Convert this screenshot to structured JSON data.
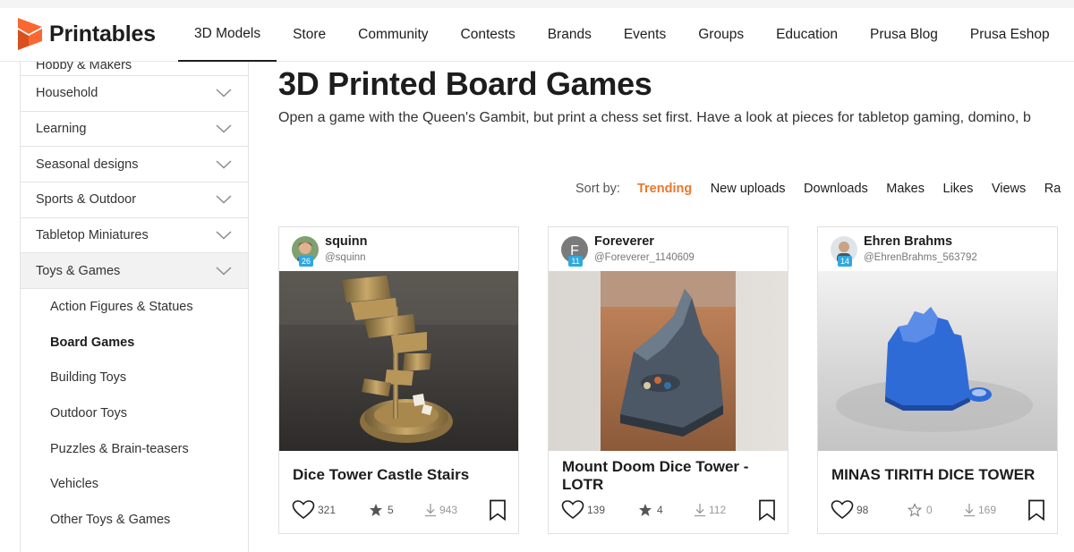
{
  "brand": {
    "name": "Printables"
  },
  "nav": [
    {
      "label": "3D Models",
      "active": true
    },
    {
      "label": "Store"
    },
    {
      "label": "Community"
    },
    {
      "label": "Contests"
    },
    {
      "label": "Brands"
    },
    {
      "label": "Events"
    },
    {
      "label": "Groups"
    },
    {
      "label": "Education"
    },
    {
      "label": "Prusa Blog"
    },
    {
      "label": "Prusa Eshop"
    }
  ],
  "sidebar": {
    "categories": [
      {
        "label": "Hobby & Makers"
      },
      {
        "label": "Household"
      },
      {
        "label": "Learning"
      },
      {
        "label": "Seasonal designs"
      },
      {
        "label": "Sports & Outdoor"
      },
      {
        "label": "Tabletop Miniatures"
      },
      {
        "label": "Toys & Games"
      }
    ],
    "subcategories": [
      {
        "label": "Action Figures & Statues"
      },
      {
        "label": "Board Games"
      },
      {
        "label": "Building Toys"
      },
      {
        "label": "Outdoor Toys"
      },
      {
        "label": "Puzzles & Brain-teasers"
      },
      {
        "label": "Vehicles"
      },
      {
        "label": "Other Toys & Games"
      }
    ],
    "selected": "Board Games"
  },
  "page": {
    "title": "3D Printed Board Games",
    "description": "Open a game with the Queen's Gambit, but print a chess set first. Have a look at pieces for tabletop gaming, domino, b"
  },
  "sort": {
    "label": "Sort by:",
    "options": [
      "Trending",
      "New uploads",
      "Downloads",
      "Makes",
      "Likes",
      "Views",
      "Ra"
    ],
    "active": "Trending"
  },
  "cards": [
    {
      "user": {
        "name": "squinn",
        "handle": "@squinn",
        "level": "26"
      },
      "title": "Dice Tower Castle Stairs",
      "likes": "321",
      "rating": "5",
      "downloads": "943",
      "liked": false
    },
    {
      "user": {
        "name": "Foreverer",
        "handle": "@Foreverer_1140609",
        "level": "11",
        "initial": "F"
      },
      "title": "Mount Doom Dice Tower - LOTR",
      "likes": "139",
      "rating": "4",
      "downloads": "112",
      "liked": false
    },
    {
      "user": {
        "name": "Ehren Brahms",
        "handle": "@EhrenBrahms_563792",
        "level": "14"
      },
      "title": "MINAS TIRITH DICE TOWER",
      "likes": "98",
      "rating": "0",
      "downloads": "169",
      "liked": false
    }
  ],
  "colors": {
    "brand_orange": "#fa6831",
    "sort_active": "#e8782f",
    "level_badge": "#2fa8e0"
  }
}
